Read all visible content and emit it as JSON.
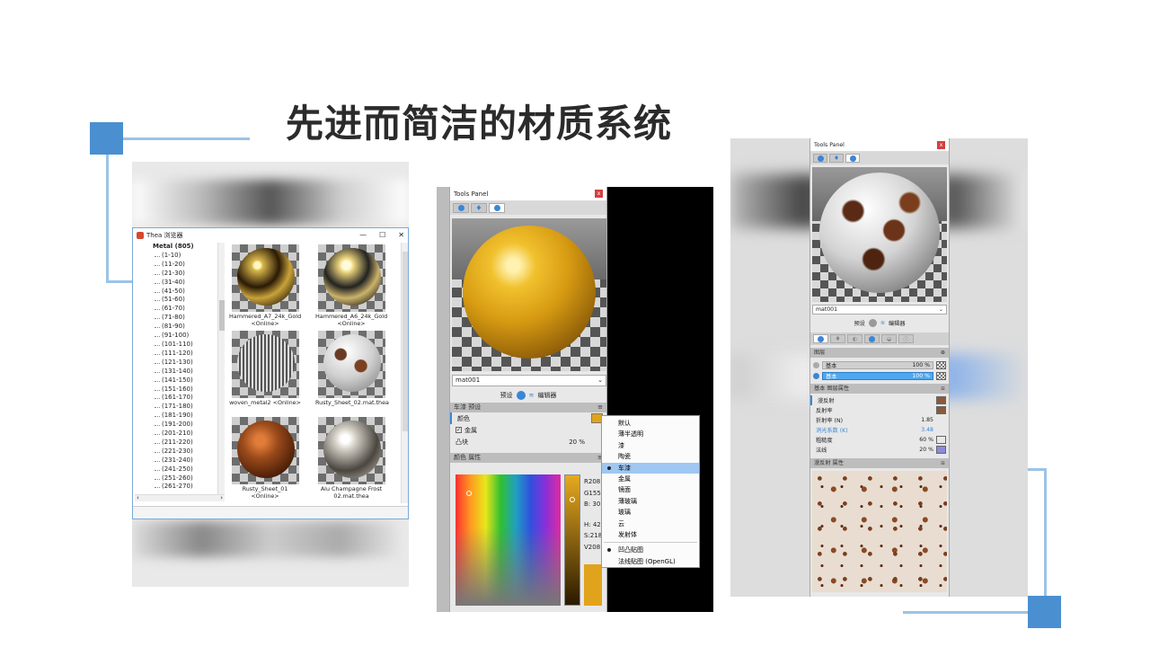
{
  "slide": {
    "title": "先进而简洁的材质系统"
  },
  "browser": {
    "window_title": "Thea 浏览器",
    "controls": [
      "—",
      "☐",
      "✕"
    ],
    "tree_root": "Metal (805)",
    "tree_nodes": [
      "(1-10)",
      "(11-20)",
      "(21-30)",
      "(31-40)",
      "(41-50)",
      "(51-60)",
      "(61-70)",
      "(71-80)",
      "(81-90)",
      "(91-100)",
      "(101-110)",
      "(111-120)",
      "(121-130)",
      "(131-140)",
      "(141-150)",
      "(151-160)",
      "(161-170)",
      "(171-180)",
      "(181-190)",
      "(191-200)",
      "(201-210)",
      "(211-220)",
      "(221-230)",
      "(231-240)",
      "(241-250)",
      "(251-260)",
      "(261-270)"
    ],
    "thumbnails": [
      {
        "name": "Hammered_A7_24k_Gold",
        "sub": "<Online>"
      },
      {
        "name": "Hammered_A6_24k_Gold",
        "sub": "<Online>"
      },
      {
        "name": "woven_metal2 <Online>",
        "sub": ""
      },
      {
        "name": "Rusty_Sheet_02.mat.thea",
        "sub": ""
      },
      {
        "name": "Rusty_Sheet_01 <Online>",
        "sub": ""
      },
      {
        "name": "Alu Champagne Frost",
        "sub": "02.mat.thea"
      }
    ]
  },
  "tools_mid": {
    "title": "Tools Panel",
    "close": "x",
    "material": "mat001",
    "preset_label": "预设",
    "editor_label": "编辑器",
    "section_title": "车漆 预设",
    "color_label": "颜色",
    "metal_label": "金属",
    "bump_label": "凸块",
    "bump_value": "20 %",
    "color_section": "颜色 属性",
    "rgb": {
      "r": "R208",
      "g": "G155",
      "b": "B: 30"
    },
    "hsv": {
      "h": "H: 42",
      "s": "S:218",
      "v": "V208"
    },
    "menu_items": [
      "默认",
      "薄半透明",
      "漆",
      "陶瓷",
      "车漆",
      "金属",
      "镜面",
      "薄玻璃",
      "玻璃",
      "云",
      "发射体"
    ],
    "menu_selected": "车漆",
    "menu_extra": [
      "凹凸贴图",
      "法线贴图 (OpenGL)"
    ]
  },
  "tools_right": {
    "title": "Tools Panel",
    "close": "x",
    "material": "mat001",
    "preset_label": "预设",
    "editor_label": "编辑器",
    "layers_head": "图层",
    "layers": [
      {
        "name": "基本",
        "value": "100 %"
      },
      {
        "name": "基本",
        "value": "100 %"
      }
    ],
    "layer_props_head": "基本 图层属性",
    "props": [
      {
        "label": "漫反射",
        "value": ""
      },
      {
        "label": "反射率",
        "value": ""
      },
      {
        "label": "折射率 (N)",
        "value": "1.85"
      },
      {
        "label": "消光系数 (K)",
        "value": "3.48"
      },
      {
        "label": "粗糙度",
        "value": "60 %"
      },
      {
        "label": "法线",
        "value": "20 %"
      }
    ],
    "diffuse_head": "漫反射 属性"
  },
  "colors": {
    "accent": "#4a8fd0",
    "frame": "#9cc3e6",
    "gold": "#e2a31c"
  }
}
